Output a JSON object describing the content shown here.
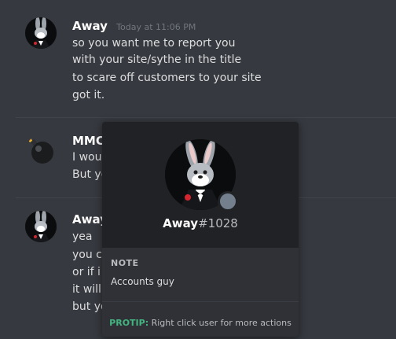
{
  "messages": [
    {
      "username": "Away",
      "timestamp": "Today at 11:06 PM",
      "lines": [
        "so you want me to report you",
        "with your site/sythe in the title",
        "to scare off customers to your site",
        "got it."
      ]
    },
    {
      "username": "MMC",
      "lines": [
        "I woul",
        "But yo"
      ]
    },
    {
      "username": "Away",
      "lines": [
        "yea",
        "you ca",
        "or if i",
        "it will",
        "but yo"
      ]
    }
  ],
  "popout": {
    "username": "Away",
    "discriminator": "#1028",
    "status": "offline",
    "note_title": "NOTE",
    "note_value": "Accounts guy",
    "protip_label": "PROTIP:",
    "protip_text": "Right click user for more actions"
  },
  "colors": {
    "background": "#36393f",
    "popout_header": "#202225",
    "protip_green": "#43b581"
  }
}
